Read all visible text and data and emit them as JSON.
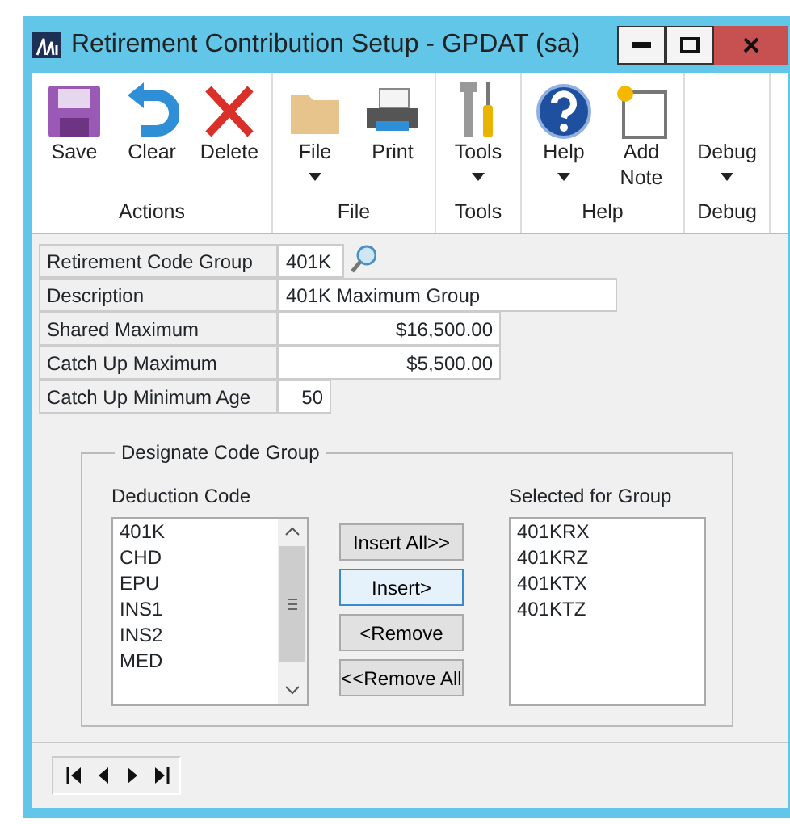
{
  "window": {
    "title": "Retirement Contribution Setup  -  GPDAT (sa)"
  },
  "ribbon": [
    {
      "label": "Actions",
      "buttons": [
        {
          "kind": "save",
          "label": "Save",
          "dropdown": false
        },
        {
          "kind": "clear",
          "label": "Clear",
          "dropdown": false
        },
        {
          "kind": "delete",
          "label": "Delete",
          "dropdown": false
        }
      ]
    },
    {
      "label": "File",
      "buttons": [
        {
          "kind": "folder",
          "label": "File",
          "dropdown": true
        },
        {
          "kind": "printer",
          "label": "Print",
          "dropdown": false
        }
      ]
    },
    {
      "label": "Tools",
      "buttons": [
        {
          "kind": "tools",
          "label": "Tools",
          "dropdown": true
        }
      ]
    },
    {
      "label": "Help",
      "buttons": [
        {
          "kind": "help",
          "label": "Help",
          "dropdown": true
        },
        {
          "kind": "note",
          "label": "Add Note",
          "dropdown": false
        }
      ]
    },
    {
      "label": "Debug",
      "buttons": [
        {
          "kind": "blank",
          "label": "Debug",
          "dropdown": true
        }
      ]
    }
  ],
  "fields": [
    {
      "kind": "code",
      "label": "Retirement Code Group",
      "value": "401K"
    },
    {
      "kind": "text",
      "label": "Description",
      "value": "401K Maximum Group"
    },
    {
      "kind": "amount",
      "label": "Shared Maximum",
      "value": "$16,500.00"
    },
    {
      "kind": "amount",
      "label": "Catch Up Maximum",
      "value": "$5,500.00"
    },
    {
      "kind": "number",
      "label": "Catch Up Minimum Age",
      "value": "50"
    }
  ],
  "group": {
    "title": "Designate Code Group",
    "deduction_codes": {
      "label": "Deduction Code",
      "items": [
        "401K",
        "CHD",
        "EPU",
        "INS1",
        "INS2",
        "MED"
      ]
    },
    "buttons": [
      {
        "label": "Insert All>>",
        "focused": false
      },
      {
        "label": "Insert>",
        "focused": true
      },
      {
        "label": "<Remove",
        "focused": false
      },
      {
        "label": "<<Remove All",
        "focused": false
      }
    ],
    "selected_for_group": {
      "label": "Selected for Group",
      "items": [
        "401KRX",
        "401KRZ",
        "401KTX",
        "401KTZ"
      ]
    }
  }
}
